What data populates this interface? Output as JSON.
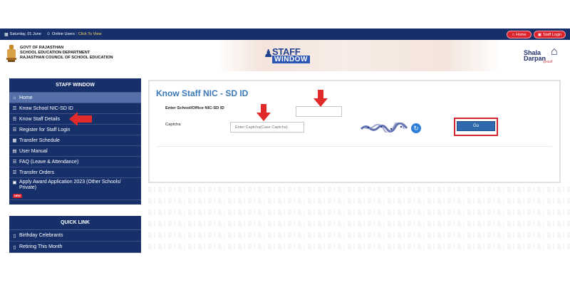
{
  "topbar": {
    "date": "Saturday, 01 June",
    "online_users_label": "Online Users :",
    "online_users_link": "Click To View",
    "home_button": "Home",
    "staff_login_button": "Staff Login"
  },
  "header": {
    "dept_line1": "GOVT OF RAJASTHAN",
    "dept_line2": "SCHOOL EDUCATION DEPARTMENT",
    "dept_line3": "RAJASTHAN COUNCIL OF SCHOOL EDUCATION",
    "logo_staff": "STAFF",
    "logo_window": "WINDOW",
    "shala_line1": "Shala",
    "shala_line2": "Darpan",
    "shala_tagline": "@staff"
  },
  "sidebar": {
    "title": "STAFF WINDOW",
    "items": [
      {
        "label": "Home",
        "icon": "home-icon"
      },
      {
        "label": "Know School NIC-SD ID",
        "icon": "list-icon"
      },
      {
        "label": "Know Staff Details",
        "icon": "list-icon"
      },
      {
        "label": "Register for Staff Login",
        "icon": "list-icon"
      },
      {
        "label": "Transfer Schedule",
        "icon": "calendar-icon"
      },
      {
        "label": "User Manual",
        "icon": "book-icon"
      },
      {
        "label": "FAQ (Leave & Attendance)",
        "icon": "list-icon"
      },
      {
        "label": "Transfer Orders",
        "icon": "list-icon"
      },
      {
        "label": "Apply Award Application 2023 (Other Schools/ Private)",
        "icon": "card-icon",
        "badge": "NEW"
      }
    ]
  },
  "quicklink": {
    "title": "QUICK LINK",
    "items": [
      {
        "label": "Birthday Celebrants",
        "icon": "document-icon"
      },
      {
        "label": "Retiring This Month",
        "icon": "document-icon"
      }
    ]
  },
  "main": {
    "title": "Know Staff NIC - SD ID",
    "nic_label": "Enter School/Office NIC-SD ID",
    "nic_value": "",
    "captcha_label": "Captcha",
    "captcha_placeholder": "Enter Captcha(Case Captcha)",
    "go_button": "Go"
  },
  "colors": {
    "navy": "#17306a",
    "accent_blue": "#3a78b8",
    "button_blue": "#2f69ad",
    "highlight_red": "#d22630"
  }
}
